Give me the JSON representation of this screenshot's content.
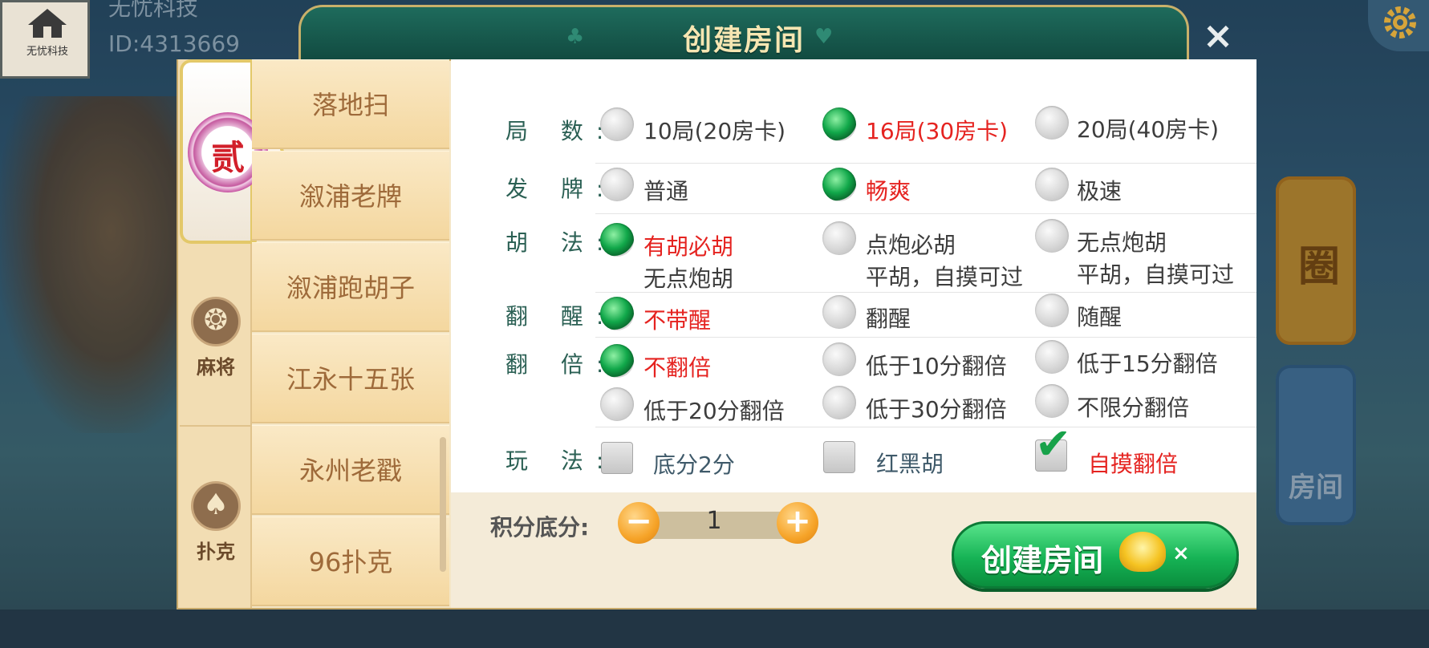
{
  "user": {
    "logo_text": "无忧科技",
    "name": "无忧科技",
    "id": "ID:4313669"
  },
  "dialog": {
    "title": "创建房间",
    "close_glyph": "×",
    "categories": [
      {
        "label": "",
        "glyph": "贰"
      },
      {
        "label": "麻将",
        "glyph": "❂"
      },
      {
        "label": "扑克",
        "glyph": "♠"
      }
    ],
    "games": [
      "落地扫",
      "溆浦老牌",
      "溆浦跑胡子",
      "江永十五张",
      "永州老戳",
      "96扑克"
    ],
    "rows": {
      "rounds": {
        "label": "局 数:",
        "options": [
          "10局(20房卡)",
          "16局(30房卡)",
          "20局(40房卡)"
        ],
        "selected": 1
      },
      "deal": {
        "label": "发 牌:",
        "options": [
          "普通",
          "畅爽",
          "极速"
        ],
        "selected": 1
      },
      "hu": {
        "label": "胡 法:",
        "options": [
          {
            "line1": "有胡必胡",
            "line2": "无点炮胡"
          },
          {
            "line1": "点炮必胡",
            "line2": "平胡，自摸可过"
          },
          {
            "line1": "无点炮胡",
            "line2": "平胡，自摸可过"
          }
        ],
        "selected": 0
      },
      "xing": {
        "label": "翻 醒:",
        "options": [
          "不带醒",
          "翻醒",
          "随醒"
        ],
        "selected": 0
      },
      "double": {
        "label": "翻 倍:",
        "options": [
          "不翻倍",
          "低于10分翻倍",
          "低于15分翻倍",
          "低于20分翻倍",
          "低于30分翻倍",
          "不限分翻倍"
        ],
        "selected": 0
      },
      "play": {
        "label": "玩 法:",
        "options": [
          "底分2分",
          "红黑胡",
          "自摸翻倍"
        ],
        "checked": [
          false,
          false,
          true
        ]
      }
    },
    "score": {
      "label": "积分底分:",
      "value": "1",
      "minus": "−",
      "plus": "+"
    },
    "create_button": {
      "label": "创建房间",
      "cost_suffix": "×"
    }
  },
  "background": {
    "card_top": "圈",
    "card_bottom": "房间"
  },
  "colors": {
    "selected_text": "#e52320",
    "label_text": "#2b6054",
    "header_green": "#1e6b5c",
    "button_green": "#16b355"
  }
}
